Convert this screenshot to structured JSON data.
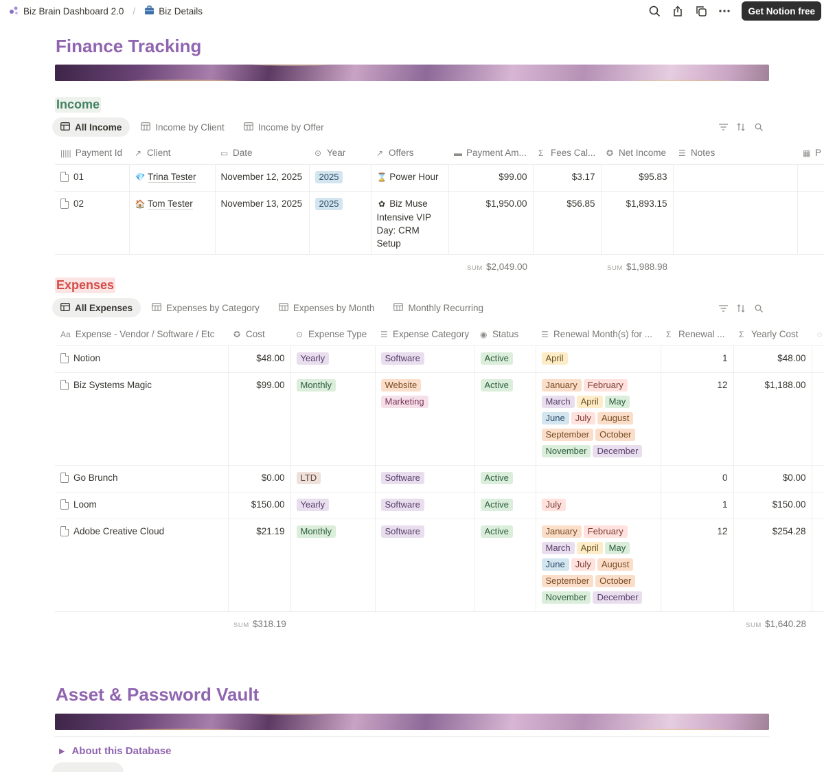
{
  "topbar": {
    "crumbs": [
      "Biz Brain Dashboard 2.0",
      "Biz Details"
    ],
    "cta": "Get Notion free"
  },
  "page": {
    "title": "Finance Tracking",
    "vault_title": "Asset & Password Vault",
    "about": "About this Database"
  },
  "income": {
    "label": "Income",
    "tabs": [
      "All Income",
      "Income by Client",
      "Income by Offer"
    ],
    "columns": [
      "Payment Id",
      "Client",
      "Date",
      "Year",
      "Offers",
      "Payment Am...",
      "Fees Cal...",
      "Net Income",
      "Notes",
      "P"
    ],
    "rows": [
      {
        "id": "01",
        "client": "Trina Tester",
        "date": "November 12, 2025",
        "year": "2025",
        "offer": "Power Hour",
        "payment": "$99.00",
        "fees": "$3.17",
        "net": "$95.83"
      },
      {
        "id": "02",
        "client": "Tom Tester",
        "date": "November 13, 2025",
        "year": "2025",
        "offer": "Biz Muse Intensive VIP Day: CRM Setup",
        "payment": "$1,950.00",
        "fees": "$56.85",
        "net": "$1,893.15"
      }
    ],
    "sum_label": "SUM",
    "sum_payment": "$2,049.00",
    "sum_net": "$1,988.98"
  },
  "expenses": {
    "label": "Expenses",
    "tabs": [
      "All Expenses",
      "Expenses by Category",
      "Expenses by Month",
      "Monthly Recurring"
    ],
    "columns": [
      "Expense - Vendor / Software / Etc",
      "Cost",
      "Expense Type",
      "Expense Category",
      "Status",
      "Renewal Month(s) for ...",
      "Renewal ...",
      "Yearly Cost"
    ],
    "rows": [
      {
        "name": "Notion",
        "cost": "$48.00",
        "type": "Yearly",
        "categories": [
          "Software"
        ],
        "status": "Active",
        "months": [
          "April"
        ],
        "renewals": "1",
        "yearly": "$48.00"
      },
      {
        "name": "Biz Systems Magic",
        "cost": "$99.00",
        "type": "Monthly",
        "categories": [
          "Website",
          "Marketing"
        ],
        "status": "Active",
        "months": [
          "January",
          "February",
          "March",
          "April",
          "May",
          "June",
          "July",
          "August",
          "September",
          "October",
          "November",
          "December"
        ],
        "renewals": "12",
        "yearly": "$1,188.00"
      },
      {
        "name": "Go Brunch",
        "cost": "$0.00",
        "type": "LTD",
        "categories": [
          "Software"
        ],
        "status": "Active",
        "months": [],
        "renewals": "0",
        "yearly": "$0.00"
      },
      {
        "name": "Loom",
        "cost": "$150.00",
        "type": "Yearly",
        "categories": [
          "Software"
        ],
        "status": "Active",
        "months": [
          "July"
        ],
        "renewals": "1",
        "yearly": "$150.00"
      },
      {
        "name": "Adobe Creative Cloud",
        "cost": "$21.19",
        "type": "Monthly",
        "categories": [
          "Software"
        ],
        "status": "Active",
        "months": [
          "January",
          "February",
          "March",
          "April",
          "May",
          "June",
          "July",
          "August",
          "September",
          "October",
          "November",
          "December"
        ],
        "renewals": "12",
        "yearly": "$254.28"
      }
    ],
    "sum_label": "SUM",
    "sum_cost": "$318.19",
    "sum_yearly": "$1,640.28"
  },
  "colors": {
    "title": "#9065b0",
    "income_label": "#448361",
    "expenses_label": "#d44c47"
  }
}
